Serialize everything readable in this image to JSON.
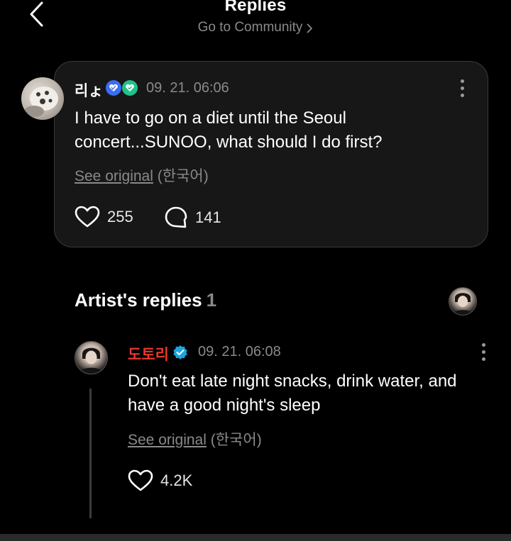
{
  "header": {
    "title": "Replies",
    "community_link": "Go to Community"
  },
  "post": {
    "username": "리ょ",
    "timestamp": "09. 21. 06:06",
    "text": "I have to go on a diet until the Seoul concert...SUNOO, what should I do first?",
    "see_original": "See original",
    "language": "(한국어)",
    "likes": "255",
    "comments": "141"
  },
  "artist_section": {
    "heading": "Artist's replies",
    "count": "1"
  },
  "reply": {
    "username": "도토리",
    "timestamp": "09. 21. 06:08",
    "text": "Don't eat late night snacks, drink water, and have a good night's sleep",
    "see_original": "See original",
    "language": "(한국어)",
    "likes": "4.2K"
  },
  "colors": {
    "background": "#000000",
    "card": "#171717",
    "muted": "#8a8a8a",
    "artist_name": "#e5392d",
    "verified": "#19a6e0",
    "badge_blue": "#3d6df2",
    "badge_green": "#22c08b"
  },
  "icons": [
    "back-chevron-icon",
    "chevron-right-icon",
    "membership-badge-icon",
    "fan-badge-icon",
    "more-vertical-icon",
    "heart-icon",
    "comment-bubble-icon",
    "verified-badge-icon"
  ]
}
